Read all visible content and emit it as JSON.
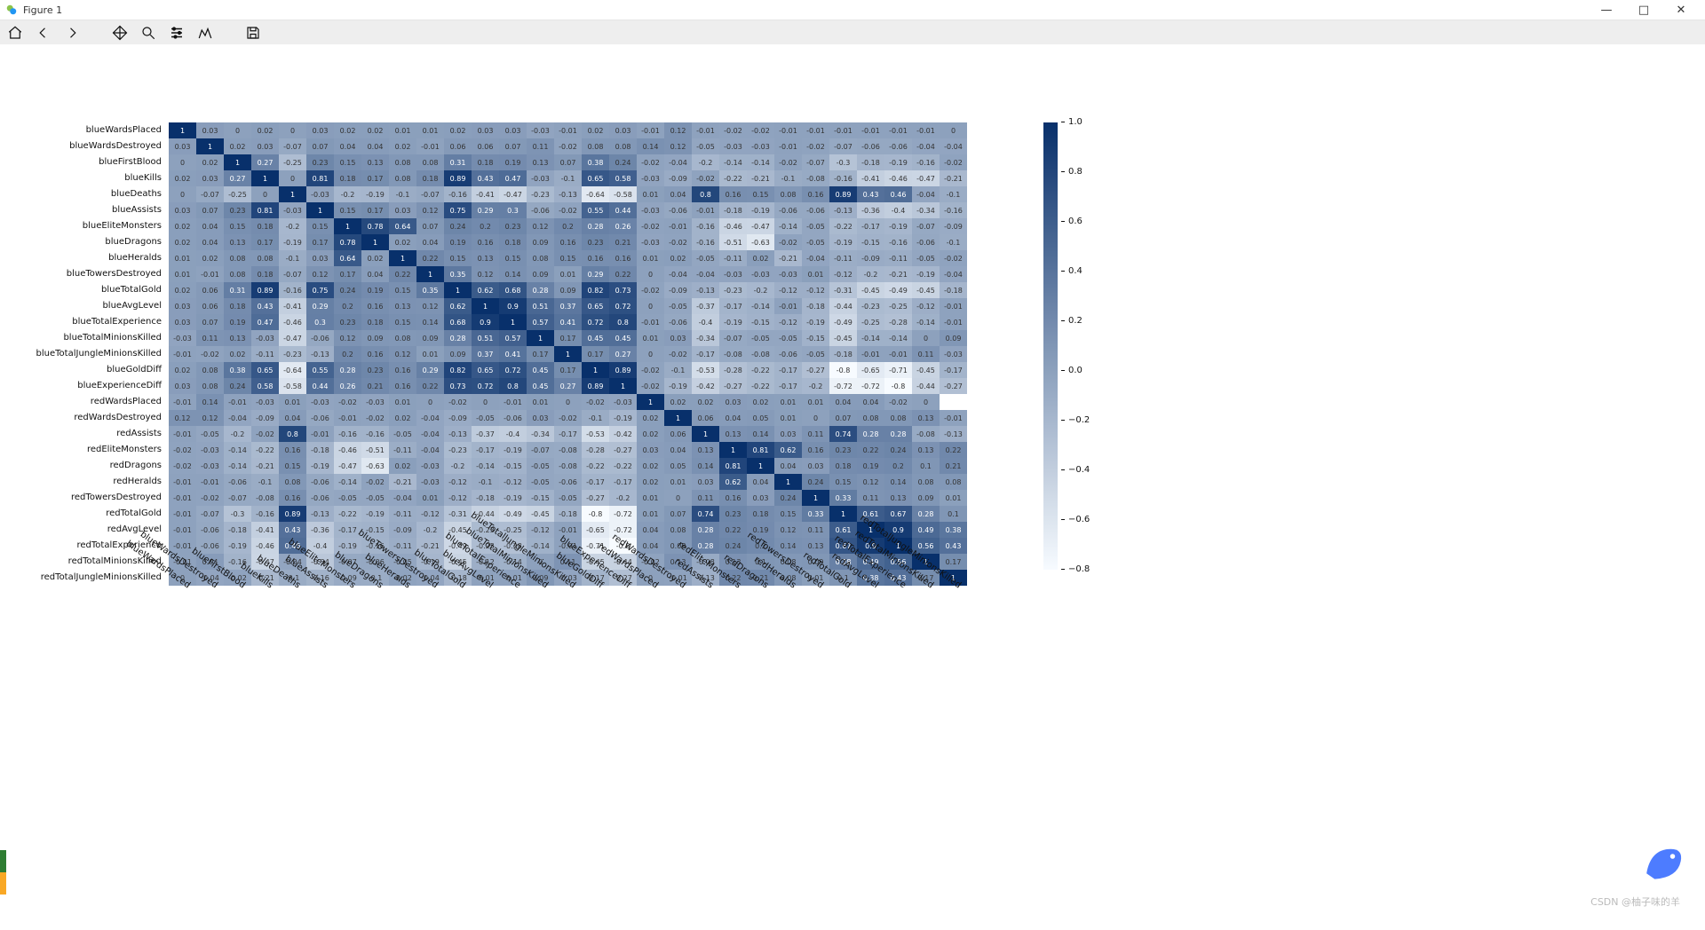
{
  "window": {
    "title": "Figure 1"
  },
  "toolbar": {
    "home": "Home",
    "back": "Back",
    "forward": "Forward",
    "pan": "Pan",
    "zoom": "Zoom",
    "configure": "Configure subplots",
    "edit": "Edit axis",
    "save": "Save figure"
  },
  "chart_data": {
    "type": "heatmap",
    "xlabel": "",
    "ylabel": "",
    "title": "",
    "vmin": -0.8,
    "vmax": 1.0,
    "colorbar_ticks": [
      1.0,
      0.8,
      0.6,
      0.4,
      0.2,
      0.0,
      -0.2,
      -0.4,
      -0.6,
      -0.8
    ],
    "labels": [
      "blueWardsPlaced",
      "blueWardsDestroyed",
      "blueFirstBlood",
      "blueKills",
      "blueDeaths",
      "blueAssists",
      "blueEliteMonsters",
      "blueDragons",
      "blueHeralds",
      "blueTowersDestroyed",
      "blueTotalGold",
      "blueAvgLevel",
      "blueTotalExperience",
      "blueTotalMinionsKilled",
      "blueTotalJungleMinionsKilled",
      "blueGoldDiff",
      "blueExperienceDiff",
      "redWardsPlaced",
      "redWardsDestroyed",
      "redAssists",
      "redEliteMonsters",
      "redDragons",
      "redHeralds",
      "redTowersDestroyed",
      "redTotalGold",
      "redAvgLevel",
      "redTotalExperience",
      "redTotalMinionsKilled",
      "redTotalJungleMinionsKilled"
    ],
    "matrix": [
      [
        1,
        0.03,
        0,
        0.02,
        0,
        0.03,
        0.02,
        0.02,
        0.01,
        0.01,
        0.02,
        0.03,
        0.03,
        -0.03,
        -0.01,
        0.02,
        0.03,
        -0.01,
        0.12,
        -0.01,
        -0.02,
        -0.02,
        -0.01,
        -0.01,
        -0.01,
        -0.01,
        -0.01,
        -0.01,
        0
      ],
      [
        0.03,
        1,
        0.02,
        0.03,
        -0.07,
        0.07,
        0.04,
        0.04,
        0.02,
        -0.01,
        0.06,
        0.06,
        0.07,
        0.11,
        -0.02,
        0.08,
        0.08,
        0.14,
        0.12,
        -0.05,
        -0.03,
        -0.03,
        -0.01,
        -0.02,
        -0.07,
        -0.06,
        -0.06,
        -0.04,
        -0.04
      ],
      [
        0,
        0.02,
        1,
        0.27,
        -0.25,
        0.23,
        0.15,
        0.13,
        0.08,
        0.08,
        0.31,
        0.18,
        0.19,
        0.13,
        0.07,
        0.38,
        0.24,
        -0.02,
        -0.04,
        -0.2,
        -0.14,
        -0.14,
        -0.02,
        -0.07,
        -0.3,
        -0.18,
        -0.19,
        -0.16,
        -0.02
      ],
      [
        0.02,
        0.03,
        0.27,
        1,
        0,
        0.81,
        0.18,
        0.17,
        0.08,
        0.18,
        0.89,
        0.43,
        0.47,
        -0.03,
        -0.1,
        0.65,
        0.58,
        -0.03,
        -0.09,
        -0.02,
        -0.22,
        -0.21,
        -0.1,
        -0.08,
        -0.16,
        -0.41,
        -0.46,
        -0.47,
        -0.21
      ],
      [
        0,
        -0.07,
        -0.25,
        0,
        1,
        -0.03,
        -0.2,
        -0.19,
        -0.1,
        -0.07,
        -0.16,
        -0.41,
        -0.47,
        -0.23,
        -0.13,
        -0.64,
        -0.58,
        0.01,
        0.04,
        0.8,
        0.16,
        0.15,
        0.08,
        0.16,
        0.89,
        0.43,
        0.46,
        -0.04,
        -0.1
      ],
      [
        0.03,
        0.07,
        0.23,
        0.81,
        -0.03,
        1,
        0.15,
        0.17,
        0.03,
        0.12,
        0.75,
        0.29,
        0.3,
        -0.06,
        -0.02,
        0.55,
        0.44,
        -0.03,
        -0.06,
        -0.01,
        -0.18,
        -0.19,
        -0.06,
        -0.06,
        -0.13,
        -0.36,
        -0.4,
        -0.34,
        -0.16
      ],
      [
        0.02,
        0.04,
        0.15,
        0.18,
        -0.2,
        0.15,
        1,
        0.78,
        0.64,
        0.07,
        0.24,
        0.2,
        0.23,
        0.12,
        0.2,
        0.28,
        0.26,
        -0.02,
        -0.01,
        -0.16,
        -0.46,
        -0.47,
        -0.14,
        -0.05,
        -0.22,
        -0.17,
        -0.19,
        -0.07,
        -0.09
      ],
      [
        0.02,
        0.04,
        0.13,
        0.17,
        -0.19,
        0.17,
        0.78,
        1,
        0.02,
        0.04,
        0.19,
        0.16,
        0.18,
        0.09,
        0.16,
        0.23,
        0.21,
        -0.03,
        -0.02,
        -0.16,
        -0.51,
        -0.63,
        -0.02,
        -0.05,
        -0.19,
        -0.15,
        -0.16,
        -0.06,
        -0.1
      ],
      [
        0.01,
        0.02,
        0.08,
        0.08,
        -0.1,
        0.03,
        0.64,
        0.02,
        1,
        0.22,
        0.15,
        0.13,
        0.15,
        0.08,
        0.15,
        0.16,
        0.16,
        0.01,
        0.02,
        -0.05,
        -0.11,
        0.02,
        -0.21,
        -0.04,
        -0.11,
        -0.09,
        -0.11,
        -0.05,
        -0.02
      ],
      [
        0.01,
        -0.01,
        0.08,
        0.18,
        -0.07,
        0.12,
        0.17,
        0.04,
        0.22,
        1,
        0.35,
        0.12,
        0.14,
        0.09,
        0.01,
        0.29,
        0.22,
        0,
        -0.04,
        -0.04,
        -0.03,
        -0.03,
        -0.03,
        0.01,
        -0.12,
        -0.2,
        -0.21,
        -0.19,
        -0.04
      ],
      [
        0.02,
        0.06,
        0.31,
        0.89,
        -0.16,
        0.75,
        0.24,
        0.19,
        0.15,
        0.35,
        1,
        0.62,
        0.68,
        0.28,
        0.09,
        0.82,
        0.73,
        -0.02,
        -0.09,
        -0.13,
        -0.23,
        -0.2,
        -0.12,
        -0.12,
        -0.31,
        -0.45,
        -0.49,
        -0.45,
        -0.18
      ],
      [
        0.03,
        0.06,
        0.18,
        0.43,
        -0.41,
        0.29,
        0.2,
        0.16,
        0.13,
        0.12,
        0.62,
        1,
        0.9,
        0.51,
        0.37,
        0.65,
        0.72,
        0,
        -0.05,
        -0.37,
        -0.17,
        -0.14,
        -0.01,
        -0.18,
        -0.44,
        -0.23,
        -0.25,
        -0.12,
        -0.01
      ],
      [
        0.03,
        0.07,
        0.19,
        0.47,
        -0.46,
        0.3,
        0.23,
        0.18,
        0.15,
        0.14,
        0.68,
        0.9,
        1,
        0.57,
        0.41,
        0.72,
        0.8,
        -0.01,
        -0.06,
        -0.4,
        -0.19,
        -0.15,
        -0.12,
        -0.19,
        -0.49,
        -0.25,
        -0.28,
        -0.14,
        -0.01
      ],
      [
        -0.03,
        0.11,
        0.13,
        -0.03,
        -0.47,
        -0.06,
        0.12,
        0.09,
        0.08,
        0.09,
        0.28,
        0.51,
        0.57,
        1,
        0.17,
        0.45,
        0.45,
        0.01,
        0.03,
        -0.34,
        -0.07,
        -0.05,
        -0.05,
        -0.15,
        -0.45,
        -0.14,
        -0.14,
        0,
        0.09
      ],
      [
        -0.01,
        -0.02,
        0.02,
        -0.11,
        -0.23,
        -0.13,
        0.2,
        0.16,
        0.12,
        0.01,
        0.09,
        0.37,
        0.41,
        0.17,
        1,
        0.17,
        0.27,
        0,
        -0.02,
        -0.17,
        -0.08,
        -0.08,
        -0.06,
        -0.05,
        -0.18,
        -0.01,
        -0.01,
        0.11,
        -0.03
      ],
      [
        0.02,
        0.08,
        0.38,
        0.65,
        -0.64,
        0.55,
        0.28,
        0.23,
        0.16,
        0.29,
        0.82,
        0.65,
        0.72,
        0.45,
        0.17,
        1,
        0.89,
        -0.02,
        -0.1,
        -0.53,
        -0.28,
        -0.22,
        -0.17,
        -0.27,
        -0.8,
        -0.65,
        -0.71,
        -0.45,
        -0.17
      ],
      [
        0.03,
        0.08,
        0.24,
        0.58,
        -0.58,
        0.44,
        0.26,
        0.21,
        0.16,
        0.22,
        0.73,
        0.72,
        0.8,
        0.45,
        0.27,
        0.89,
        1,
        -0.02,
        -0.19,
        -0.42,
        -0.27,
        -0.22,
        -0.17,
        -0.2,
        -0.72,
        -0.72,
        -0.8,
        -0.44,
        -0.27
      ],
      [
        -0.01,
        0.14,
        -0.01,
        -0.03,
        0.01,
        -0.03,
        -0.02,
        -0.03,
        0.01,
        0,
        -0.02,
        0,
        -0.01,
        0.01,
        0,
        -0.02,
        -0.03,
        1,
        0.02,
        0.02,
        0.03,
        0.02,
        0.01,
        0.01,
        0.04,
        0.04,
        -0.02,
        0
      ],
      [
        0.12,
        0.12,
        -0.04,
        -0.09,
        0.04,
        -0.06,
        -0.01,
        -0.02,
        0.02,
        -0.04,
        -0.09,
        -0.05,
        -0.06,
        0.03,
        -0.02,
        -0.1,
        -0.19,
        0.02,
        1,
        0.06,
        0.04,
        0.05,
        0.01,
        0,
        0.07,
        0.08,
        0.08,
        0.13,
        -0.01
      ],
      [
        -0.01,
        -0.05,
        -0.2,
        -0.02,
        0.8,
        -0.01,
        -0.16,
        -0.16,
        -0.05,
        -0.04,
        -0.13,
        -0.37,
        -0.4,
        -0.34,
        -0.17,
        -0.53,
        -0.42,
        0.02,
        0.06,
        1,
        0.13,
        0.14,
        0.03,
        0.11,
        0.74,
        0.28,
        0.28,
        -0.08,
        -0.13
      ],
      [
        -0.02,
        -0.03,
        -0.14,
        -0.22,
        0.16,
        -0.18,
        -0.46,
        -0.51,
        -0.11,
        -0.04,
        -0.23,
        -0.17,
        -0.19,
        -0.07,
        -0.08,
        -0.28,
        -0.27,
        0.03,
        0.04,
        0.13,
        1,
        0.81,
        0.62,
        0.16,
        0.23,
        0.22,
        0.24,
        0.13,
        0.22
      ],
      [
        -0.02,
        -0.03,
        -0.14,
        -0.21,
        0.15,
        -0.19,
        -0.47,
        -0.63,
        0.02,
        -0.03,
        -0.2,
        -0.14,
        -0.15,
        -0.05,
        -0.08,
        -0.22,
        -0.22,
        0.02,
        0.05,
        0.14,
        0.81,
        1,
        0.04,
        0.03,
        0.18,
        0.19,
        0.2,
        0.1,
        0.21
      ],
      [
        -0.01,
        -0.01,
        -0.06,
        -0.1,
        0.08,
        -0.06,
        -0.14,
        -0.02,
        -0.21,
        -0.03,
        -0.12,
        -0.1,
        -0.12,
        -0.05,
        -0.06,
        -0.17,
        -0.17,
        0.02,
        0.01,
        0.03,
        0.62,
        0.04,
        1,
        0.24,
        0.15,
        0.12,
        0.14,
        0.08,
        0.08
      ],
      [
        -0.01,
        -0.02,
        -0.07,
        -0.08,
        0.16,
        -0.06,
        -0.05,
        -0.05,
        -0.04,
        0.01,
        -0.12,
        -0.18,
        -0.19,
        -0.15,
        -0.05,
        -0.27,
        -0.2,
        0.01,
        0,
        0.11,
        0.16,
        0.03,
        0.24,
        1,
        0.33,
        0.11,
        0.13,
        0.09,
        0.01
      ],
      [
        -0.01,
        -0.07,
        -0.3,
        -0.16,
        0.89,
        -0.13,
        -0.22,
        -0.19,
        -0.11,
        -0.12,
        -0.31,
        -0.44,
        -0.49,
        -0.45,
        -0.18,
        -0.8,
        -0.72,
        0.01,
        0.07,
        0.74,
        0.23,
        0.18,
        0.15,
        0.33,
        1,
        0.61,
        0.67,
        0.28,
        0.1
      ],
      [
        -0.01,
        -0.06,
        -0.18,
        -0.41,
        0.43,
        -0.36,
        -0.17,
        -0.15,
        -0.09,
        -0.2,
        -0.45,
        -0.23,
        -0.25,
        -0.12,
        -0.01,
        -0.65,
        -0.72,
        0.04,
        0.08,
        0.28,
        0.22,
        0.19,
        0.12,
        0.11,
        0.61,
        1,
        0.9,
        0.49,
        0.38
      ],
      [
        -0.01,
        -0.06,
        -0.19,
        -0.46,
        0.46,
        -0.4,
        -0.19,
        -0.16,
        -0.11,
        -0.21,
        -0.49,
        -0.25,
        -0.28,
        -0.14,
        -0.01,
        -0.71,
        -0.8,
        0.04,
        0.08,
        0.28,
        0.24,
        0.2,
        0.14,
        0.13,
        0.67,
        0.9,
        1,
        0.56,
        0.43
      ],
      [
        -0.01,
        0.04,
        -0.16,
        -0.47,
        -0.04,
        -0.34,
        -0.07,
        -0.06,
        -0.05,
        -0.19,
        -0.45,
        -0.12,
        -0.14,
        0,
        0.11,
        -0.45,
        -0.44,
        -0.02,
        0.13,
        -0.08,
        0.13,
        0.1,
        0.08,
        0.09,
        0.28,
        0.49,
        0.56,
        1,
        0.17
      ],
      [
        0,
        -0.04,
        -0.02,
        -0.21,
        -0.1,
        -0.16,
        -0.09,
        -0.1,
        -0.02,
        -0.04,
        -0.18,
        -0.01,
        -0.01,
        0.09,
        -0.03,
        -0.17,
        -0.27,
        0,
        -0.01,
        -0.13,
        0.22,
        0.21,
        0.08,
        0.01,
        0.1,
        0.38,
        0.43,
        0.17,
        1
      ]
    ]
  },
  "watermark": "CSDN @柚子味的羊"
}
